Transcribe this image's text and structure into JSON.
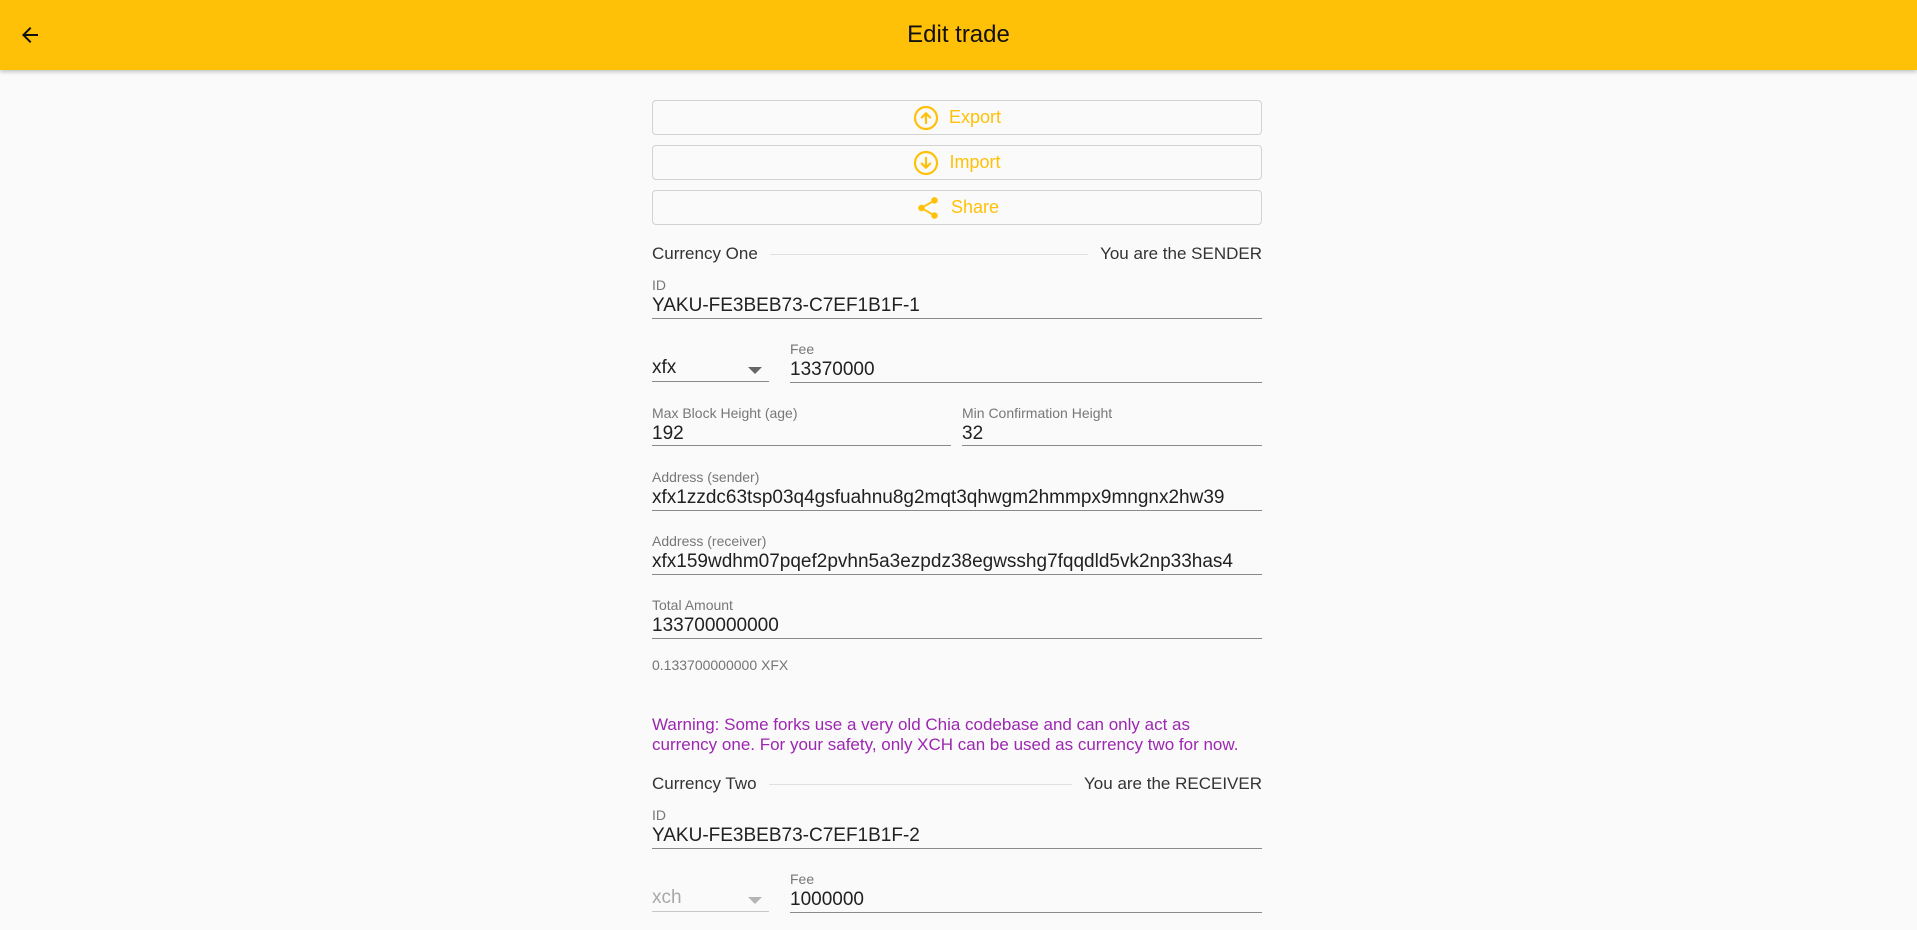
{
  "appbar": {
    "title": "Edit trade",
    "back_icon": "arrow-back-icon"
  },
  "actions": {
    "export_label": "Export",
    "export_icon": "arrow-up-circle-icon",
    "import_label": "Import",
    "import_icon": "arrow-down-circle-icon",
    "share_label": "Share",
    "share_icon": "share-icon"
  },
  "currency_one": {
    "title": "Currency One",
    "role": "You are the SENDER",
    "id_label": "ID",
    "id_value": "YAKU-FE3BEB73-C7EF1B1F-1",
    "currency": "xfx",
    "fee_label": "Fee",
    "fee_value": "13370000",
    "max_block_label": "Max Block Height (age)",
    "max_block_value": "192",
    "min_conf_label": "Min Confirmation Height",
    "min_conf_value": "32",
    "address_sender_label": "Address (sender)",
    "address_sender_value": "xfx1zzdc63tsp03q4gsfuahnu8g2mqt3qhwgm2hmmpx9mngnx2hw39",
    "address_receiver_label": "Address (receiver)",
    "address_receiver_value": "xfx159wdhm07pqef2pvhn5a3ezpdz38egwsshg7fqqdld5vk2np33has4",
    "total_amount_label": "Total Amount",
    "total_amount_value": "133700000000",
    "amount_helper": "0.133700000000 XFX"
  },
  "warning": "Warning: Some forks use a very old Chia codebase and can only act as currency one. For your safety, only XCH can be used as currency two for now.",
  "currency_two": {
    "title": "Currency Two",
    "role": "You are the RECEIVER",
    "id_label": "ID",
    "id_value": "YAKU-FE3BEB73-C7EF1B1F-2",
    "currency": "xch",
    "fee_label": "Fee",
    "fee_value": "1000000"
  },
  "colors": {
    "appbar": "#ffc107",
    "accent": "#ffc107",
    "warning": "#9c27b0",
    "background": "#fafafa"
  }
}
